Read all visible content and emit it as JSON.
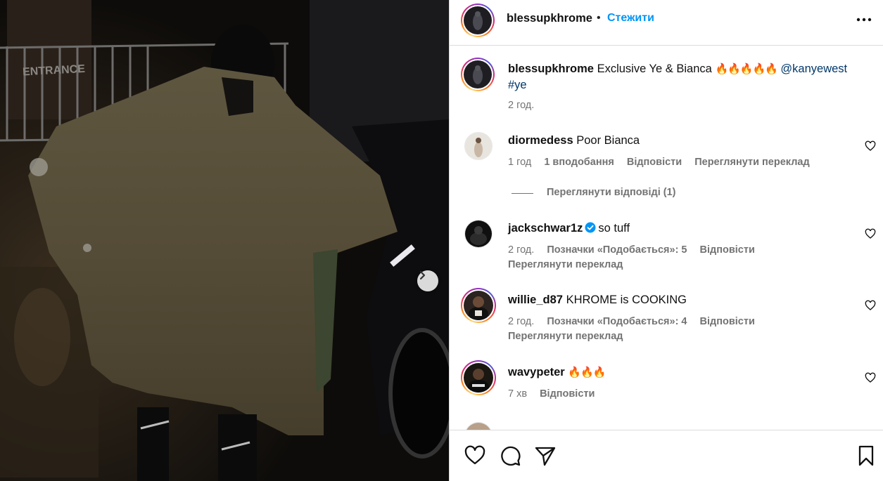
{
  "post": {
    "author": "blessupkhrome",
    "follow_label": "Стежити",
    "separator": "•"
  },
  "caption": {
    "username": "blessupkhrome",
    "text": "Exclusive Ye & Bianca",
    "emojis": "🔥🔥🔥🔥🔥",
    "mention": "@kanyewest",
    "hashtag": "#ye",
    "time": "2 год."
  },
  "comments": [
    {
      "username": "diormedess",
      "text": "Poor Bianca",
      "time": "1 год",
      "likes": "1 вподобання",
      "reply": "Відповісти",
      "translate": "Переглянути переклад",
      "view_replies": "Переглянути відповіді (1)"
    },
    {
      "username": "jackschwar1z",
      "verified": true,
      "text": "so tuff",
      "time": "2 год.",
      "likes": "Позначки «Подобається»: 5",
      "reply": "Відповісти",
      "translate": "Переглянути переклад"
    },
    {
      "username": "willie_d87",
      "text": "KHROME is COOKING",
      "time": "2 год.",
      "likes": "Позначки «Подобається»: 4",
      "reply": "Відповісти",
      "translate": "Переглянути переклад"
    },
    {
      "username": "wavypeter",
      "text": "🔥🔥🔥",
      "time": "7 хв",
      "reply": "Відповісти"
    }
  ],
  "icons": {
    "like": "heart-icon",
    "comment": "comment-icon",
    "share": "send-icon",
    "save": "bookmark-icon",
    "more": "more-options-icon",
    "carousel": "chevron-right-icon",
    "verified": "verified-badge-icon"
  },
  "colors": {
    "link_blue": "#0095f6",
    "mention_blue": "#00376b",
    "muted": "#737373",
    "verified": "#0095f6"
  }
}
